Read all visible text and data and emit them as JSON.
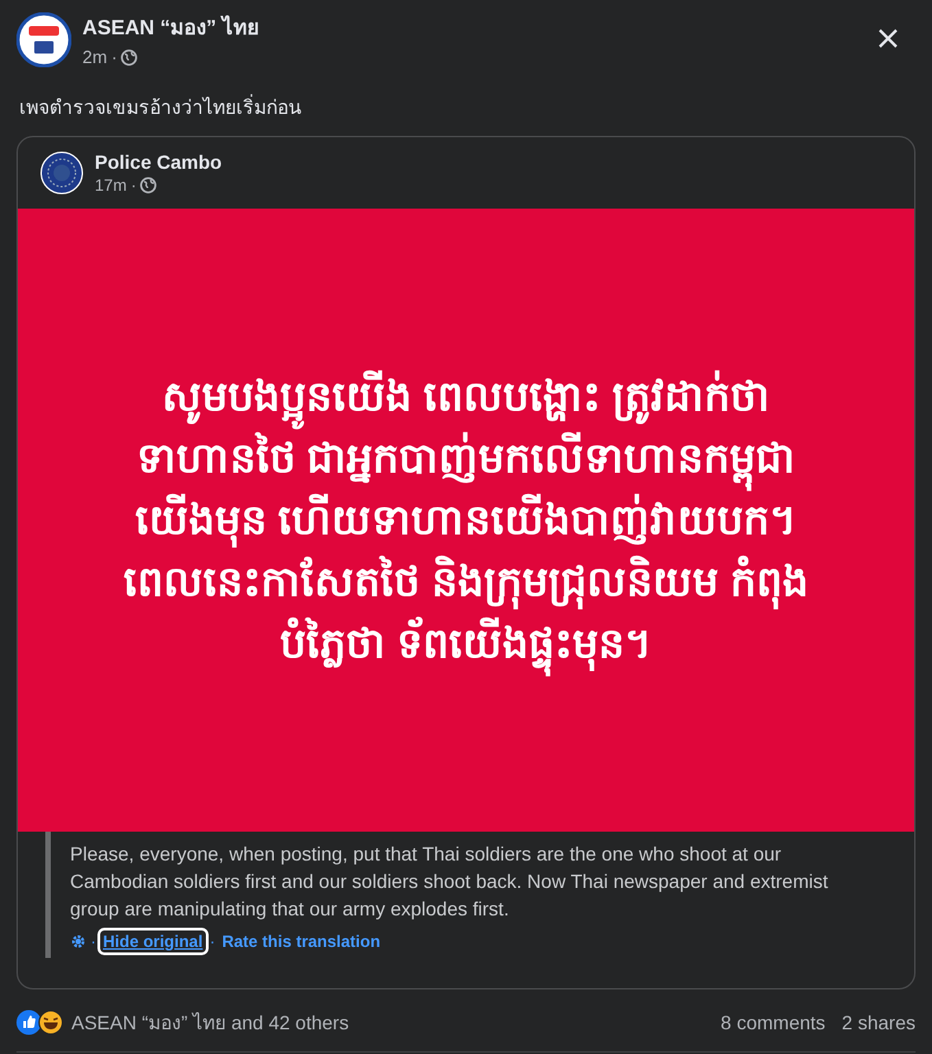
{
  "post": {
    "author": "ASEAN “มอง” ไทย",
    "time": "2m",
    "separator": "·",
    "caption": "เพจตำรวจเขมรอ้างว่าไทยเริ่มก่อน"
  },
  "shared_post": {
    "author": "Police Cambo",
    "time": "17m",
    "image_lines": [
      "សូមបងប្អូនយើង ពេលបង្ហោះ ត្រូវដាក់ថា",
      "ទាហានថៃ ជាអ្នកបាញ់មកលើទាហានកម្ពុជា",
      "យើងមុន ហើយទាហានយើងបាញ់វាយបក។",
      "ពេលនេះកាសែតថៃ និងក្រុមជ្រុលនិយម កំពុង",
      "បំភ្លៃថា ទ័ពយើងផ្ទុះមុន។"
    ],
    "separator": "·",
    "translation": "Please, everyone, when posting, put that Thai soldiers are the one who shoot at our Cambodian soldiers first and our soldiers shoot back. Now Thai newspaper and extremist group are manipulating that our army explodes first.",
    "translation_separator": "·",
    "translation_links": [
      {
        "label": "Hide original",
        "focused": true
      },
      {
        "label": "Rate this translation",
        "focused": false
      }
    ]
  },
  "reactions": {
    "summary": "ASEAN “มอง” ไทย and 42 others",
    "comments": "8 comments",
    "shares": "2 shares"
  }
}
